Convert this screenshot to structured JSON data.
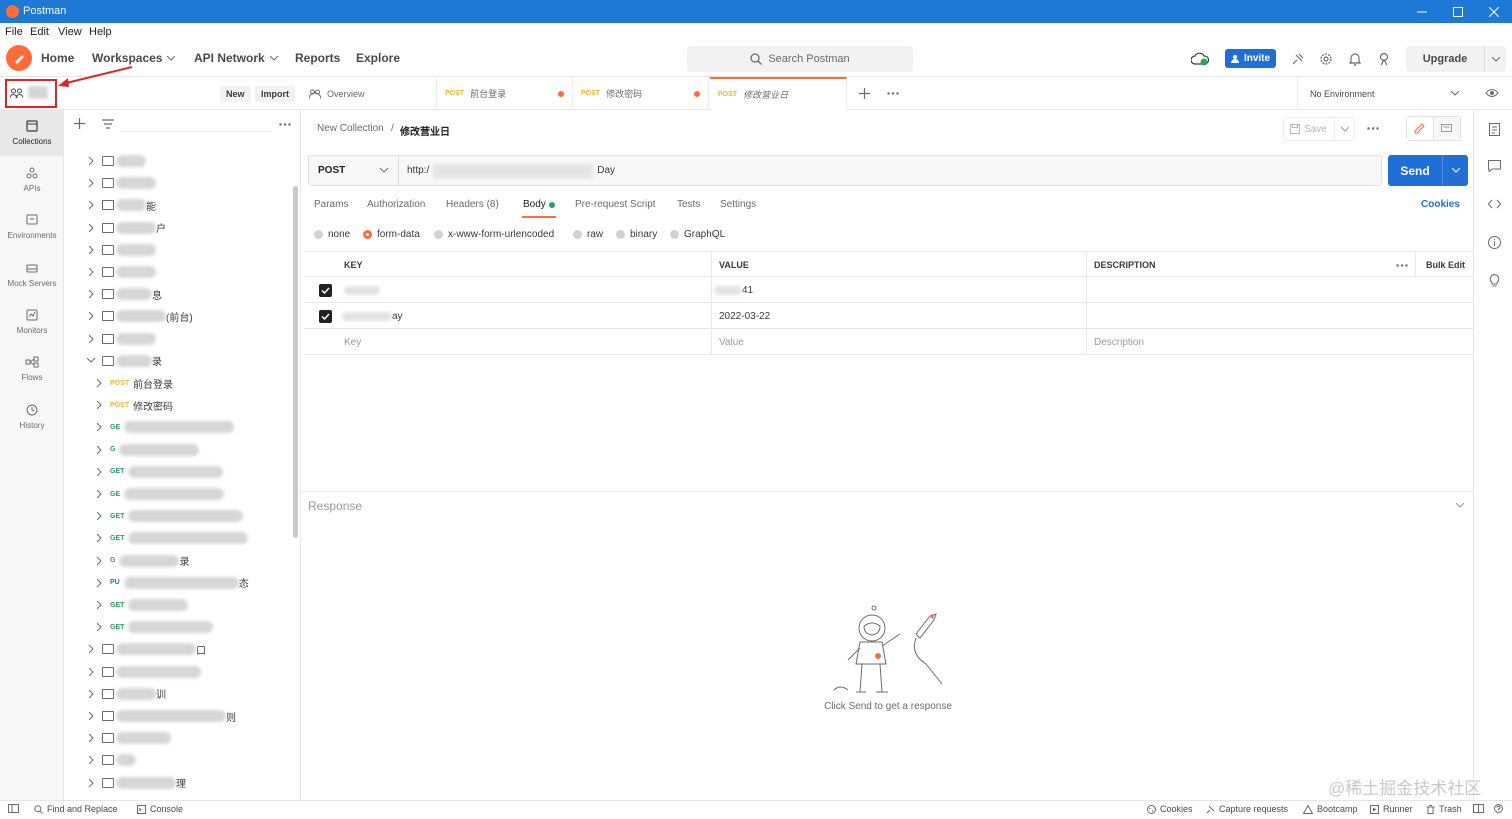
{
  "window": {
    "title": "Postman"
  },
  "menu": [
    "File",
    "Edit",
    "View",
    "Help"
  ],
  "header": {
    "nav": [
      {
        "label": "Home",
        "dropdown": false
      },
      {
        "label": "Workspaces",
        "dropdown": true
      },
      {
        "label": "API Network",
        "dropdown": true
      },
      {
        "label": "Reports",
        "dropdown": false
      },
      {
        "label": "Explore",
        "dropdown": false
      }
    ],
    "search_placeholder": "Search Postman",
    "invite_label": "Invite",
    "upgrade_label": "Upgrade"
  },
  "workspace_bar": {
    "new_label": "New",
    "import_label": "Import"
  },
  "left_nav": [
    {
      "label": "Collections",
      "icon": "collections-icon"
    },
    {
      "label": "APIs",
      "icon": "apis-icon"
    },
    {
      "label": "Environments",
      "icon": "environments-icon"
    },
    {
      "label": "Mock Servers",
      "icon": "mock-servers-icon"
    },
    {
      "label": "Monitors",
      "icon": "monitors-icon"
    },
    {
      "label": "Flows",
      "icon": "flows-icon"
    },
    {
      "label": "History",
      "icon": "history-icon"
    }
  ],
  "tree": [
    {
      "type": "folder",
      "suffix": "",
      "w": 30
    },
    {
      "type": "folder",
      "suffix": "",
      "w": 40
    },
    {
      "type": "folder",
      "suffix": "能",
      "w": 30
    },
    {
      "type": "folder",
      "suffix": "户",
      "w": 40
    },
    {
      "type": "folder",
      "suffix": "",
      "w": 40
    },
    {
      "type": "folder",
      "suffix": "",
      "w": 40
    },
    {
      "type": "folder",
      "suffix": "息",
      "w": 36
    },
    {
      "type": "folder",
      "suffix": "(前台)",
      "w": 50
    },
    {
      "type": "folder",
      "suffix": "",
      "w": 40
    },
    {
      "type": "folder-open",
      "suffix": "录",
      "w": 36
    },
    {
      "type": "request",
      "method": "POST",
      "name": "前台登录"
    },
    {
      "type": "request",
      "method": "POST",
      "name": "修改密码"
    },
    {
      "type": "request",
      "method": "GE",
      "name": "",
      "w": 110
    },
    {
      "type": "request",
      "method": "G",
      "name": "",
      "w": 80
    },
    {
      "type": "request",
      "method": "GET",
      "name": "",
      "w": 95
    },
    {
      "type": "request",
      "method": "GE",
      "name": "",
      "w": 100
    },
    {
      "type": "request",
      "method": "GET",
      "name": "",
      "w": 115
    },
    {
      "type": "request",
      "method": "GET",
      "name": "",
      "w": 120
    },
    {
      "type": "request",
      "method": "G",
      "name": "录",
      "w": 60
    },
    {
      "type": "request",
      "method": "PU",
      "name": "态",
      "w": 115
    },
    {
      "type": "request",
      "method": "GET",
      "name": "",
      "w": 60
    },
    {
      "type": "request",
      "method": "GET",
      "name": "",
      "w": 85
    },
    {
      "type": "folder",
      "suffix": "口",
      "w": 80
    },
    {
      "type": "folder",
      "suffix": "",
      "w": 85
    },
    {
      "type": "folder",
      "suffix": "训",
      "w": 40
    },
    {
      "type": "folder",
      "suffix": "则",
      "w": 110
    },
    {
      "type": "folder",
      "suffix": "",
      "w": 55
    },
    {
      "type": "folder",
      "suffix": "",
      "w": 20
    },
    {
      "type": "folder",
      "suffix": "理",
      "w": 60
    }
  ],
  "tabs": [
    {
      "method": "",
      "label": "Overview",
      "unsaved": false
    },
    {
      "method": "POST",
      "label": "前台登录",
      "unsaved": true
    },
    {
      "method": "POST",
      "label": "修改密码",
      "unsaved": true
    },
    {
      "method": "POST",
      "label": "修改营业日",
      "unsaved": false
    }
  ],
  "environment": "No Environment",
  "request": {
    "breadcrumb_collection": "New Collection",
    "breadcrumb_sep": "/",
    "breadcrumb_name": "修改营业日",
    "save_label": "Save",
    "method": "POST",
    "url_start": "http:/",
    "url_end": "Day",
    "send_label": "Send",
    "tabs": [
      "Params",
      "Authorization",
      "Headers (8)",
      "Body",
      "Pre-request Script",
      "Tests",
      "Settings"
    ],
    "cookies_label": "Cookies",
    "body_types": [
      "none",
      "form-data",
      "x-www-form-urlencoded",
      "raw",
      "binary",
      "GraphQL"
    ],
    "selected_body_type": "form-data",
    "table": {
      "headers": [
        "KEY",
        "VALUE",
        "DESCRIPTION"
      ],
      "bulk_edit_label": "Bulk Edit",
      "rows": [
        {
          "key": "",
          "value": "41"
        },
        {
          "key": "ay",
          "value": "2022-03-22"
        }
      ],
      "placeholder": {
        "key": "Key",
        "value": "Value",
        "description": "Description"
      }
    }
  },
  "response": {
    "title": "Response",
    "hint": "Click Send to get a response"
  },
  "statusbar": {
    "left": [
      {
        "label": "Find and Replace"
      },
      {
        "label": "Console"
      }
    ],
    "right": [
      {
        "label": "Cookies"
      },
      {
        "label": "Capture requests"
      },
      {
        "label": "Bootcamp"
      },
      {
        "label": "Runner"
      },
      {
        "label": "Trash"
      }
    ]
  },
  "watermark": "@稀土掘金技术社区",
  "colors": {
    "brand": "#ff6c37",
    "primary": "#1f6fd6",
    "titlebar": "#1d78d6"
  }
}
